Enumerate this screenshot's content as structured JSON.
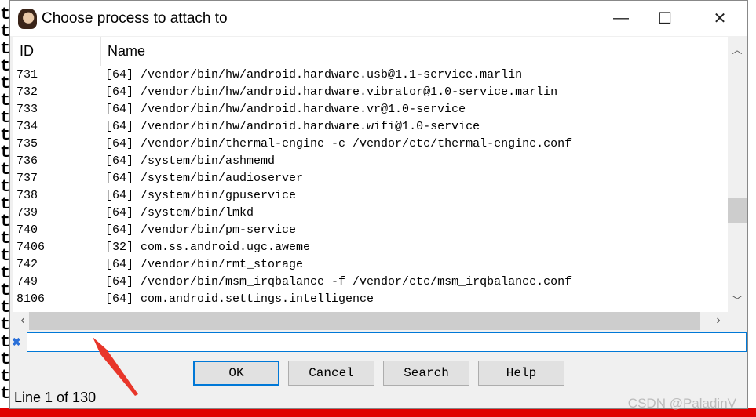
{
  "window": {
    "title": "Choose process to attach to",
    "minimize": "—",
    "maximize": "☐",
    "close": "✕"
  },
  "columns": {
    "id": "ID",
    "name": "Name"
  },
  "rows": [
    {
      "id": "731",
      "name": "[64] /vendor/bin/hw/android.hardware.usb@1.1-service.marlin"
    },
    {
      "id": "732",
      "name": "[64] /vendor/bin/hw/android.hardware.vibrator@1.0-service.marlin"
    },
    {
      "id": "733",
      "name": "[64] /vendor/bin/hw/android.hardware.vr@1.0-service"
    },
    {
      "id": "734",
      "name": "[64] /vendor/bin/hw/android.hardware.wifi@1.0-service"
    },
    {
      "id": "735",
      "name": "[64] /vendor/bin/thermal-engine -c /vendor/etc/thermal-engine.conf"
    },
    {
      "id": "736",
      "name": "[64] /system/bin/ashmemd"
    },
    {
      "id": "737",
      "name": "[64] /system/bin/audioserver"
    },
    {
      "id": "738",
      "name": "[64] /system/bin/gpuservice"
    },
    {
      "id": "739",
      "name": "[64] /system/bin/lmkd"
    },
    {
      "id": "740",
      "name": "[64] /vendor/bin/pm-service"
    },
    {
      "id": "7406",
      "name": "[32] com.ss.android.ugc.aweme"
    },
    {
      "id": "742",
      "name": "[64] /vendor/bin/rmt_storage"
    },
    {
      "id": "749",
      "name": "[64] /vendor/bin/msm_irqbalance -f /vendor/etc/msm_irqbalance.conf"
    },
    {
      "id": "8106",
      "name": "[64] com.android.settings.intelligence"
    }
  ],
  "filter": {
    "value": "",
    "icon": "clear-filter-icon"
  },
  "buttons": {
    "ok": "OK",
    "cancel": "Cancel",
    "search": "Search",
    "help": "Help"
  },
  "status": "Line 1 of 130",
  "watermark": "CSDN @PaladinV",
  "background_chars": "t",
  "colors": {
    "accent": "#0078d7",
    "annotation_arrow": "#e8362a"
  }
}
